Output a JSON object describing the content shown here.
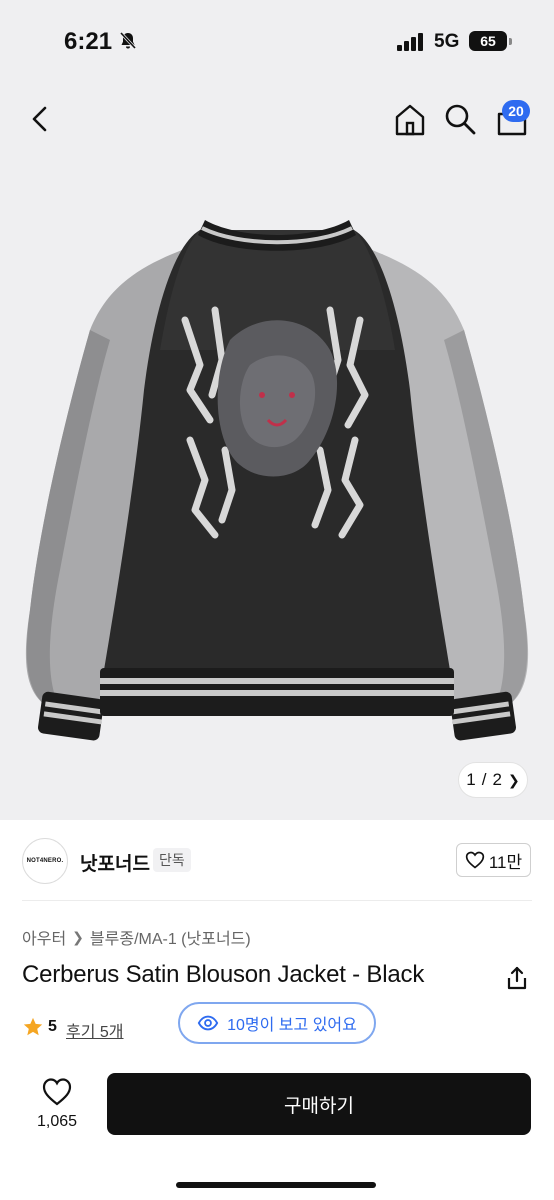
{
  "status_bar": {
    "time": "6:21",
    "network": "5G",
    "battery": "65"
  },
  "nav": {
    "cart_count": "20"
  },
  "image": {
    "counter_current": "1",
    "counter_separator": "/",
    "counter_total": "2"
  },
  "brand": {
    "logo_text": "NOT4NERO.",
    "name": "낫포너드",
    "tag": "단독",
    "likes": "11만"
  },
  "breadcrumb": {
    "items": [
      "아우터",
      "블루종/MA-1 (낫포너드)"
    ]
  },
  "product": {
    "title": "Cerberus Satin Blouson Jacket - Black",
    "rating": "5",
    "reviews": "후기 5개",
    "viewers": "10명이 보고 있어요"
  },
  "bottom_bar": {
    "wish_count": "1,065",
    "buy_label": "구매하기"
  },
  "colors": {
    "accent": "#2e6bf0",
    "star": "#f5a623",
    "buy_button": "#111111",
    "image_bg": "#efeff1"
  },
  "icons": {
    "back": "chevron-left-icon",
    "home": "home-icon",
    "search": "search-icon",
    "cart": "cart-icon",
    "share": "share-icon",
    "star": "star-icon",
    "eye": "eye-icon",
    "heart": "heart-icon"
  }
}
